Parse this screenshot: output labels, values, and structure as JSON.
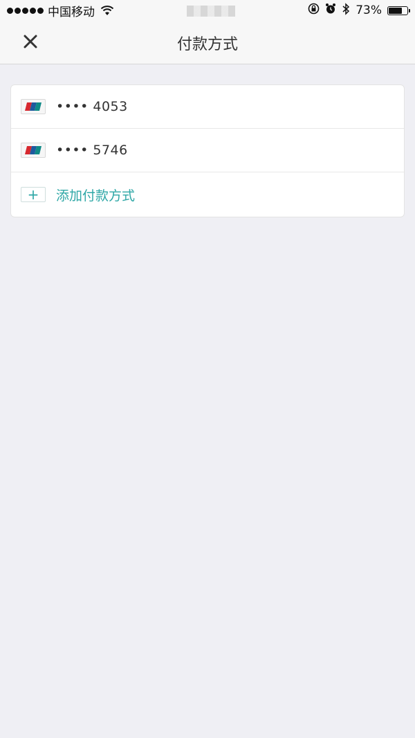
{
  "status_bar": {
    "carrier": "中国移动",
    "battery_percent": 73,
    "battery_text": "73%"
  },
  "nav": {
    "title": "付款方式",
    "close_icon": "close-icon"
  },
  "payment_methods": [
    {
      "masked_number": "•••• 4053",
      "card_icon": "unionpay-card-icon"
    },
    {
      "masked_number": "•••• 5746",
      "card_icon": "unionpay-card-icon"
    }
  ],
  "add_method": {
    "label": "添加付款方式",
    "icon": "plus-icon"
  },
  "colors": {
    "accent": "#2ea7a6",
    "background": "#efeff4",
    "nav_bg": "#f7f7f7",
    "unionpay_red": "#d7282f",
    "unionpay_blue": "#1e5a9e",
    "unionpay_teal": "#0f8a87"
  }
}
